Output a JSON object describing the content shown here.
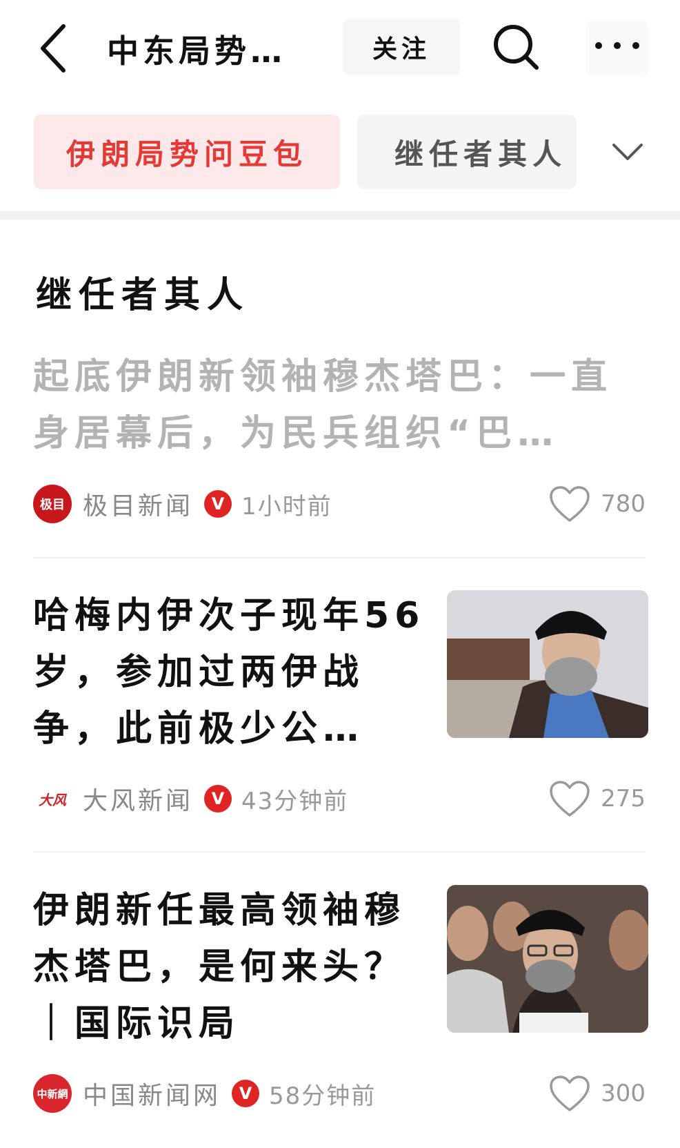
{
  "header": {
    "title": "中东局势…",
    "follow_label": "关注"
  },
  "tabs": [
    {
      "label": "伊朗局势问豆包",
      "active": true
    },
    {
      "label": "继任者其人",
      "active": false
    }
  ],
  "section_title": "继任者其人",
  "articles": [
    {
      "title_lines": [
        "起底伊朗新领袖穆杰塔巴：一直",
        "身居幕后，为民兵组织“巴…"
      ],
      "source": "极目新闻",
      "logo_text": "极目",
      "time": "1小时前",
      "likes": "780",
      "read": true
    },
    {
      "title_lines": [
        "哈梅内伊次子现年56",
        "岁，参加过两伊战",
        "争，此前极少公…"
      ],
      "source": "大风新闻",
      "logo_text": "大风",
      "time": "43分钟前",
      "likes": "275",
      "read": false
    },
    {
      "title_lines": [
        "伊朗新任最高领袖穆",
        "杰塔巴，是何来头？",
        "｜国际识局"
      ],
      "source": "中国新闻网",
      "logo_text": "中新網",
      "time": "58分钟前",
      "likes": "300",
      "read": false
    }
  ],
  "colors": {
    "accent": "#e53935",
    "active_tab_bg": "#fde9e9",
    "verified_badge": "#e02424"
  },
  "icons": {
    "back": "chevron-left-icon",
    "search": "search-icon",
    "more": "more-dots-icon",
    "expand": "chevron-down-icon",
    "like": "heart-icon",
    "verified": "verified-v-icon"
  }
}
